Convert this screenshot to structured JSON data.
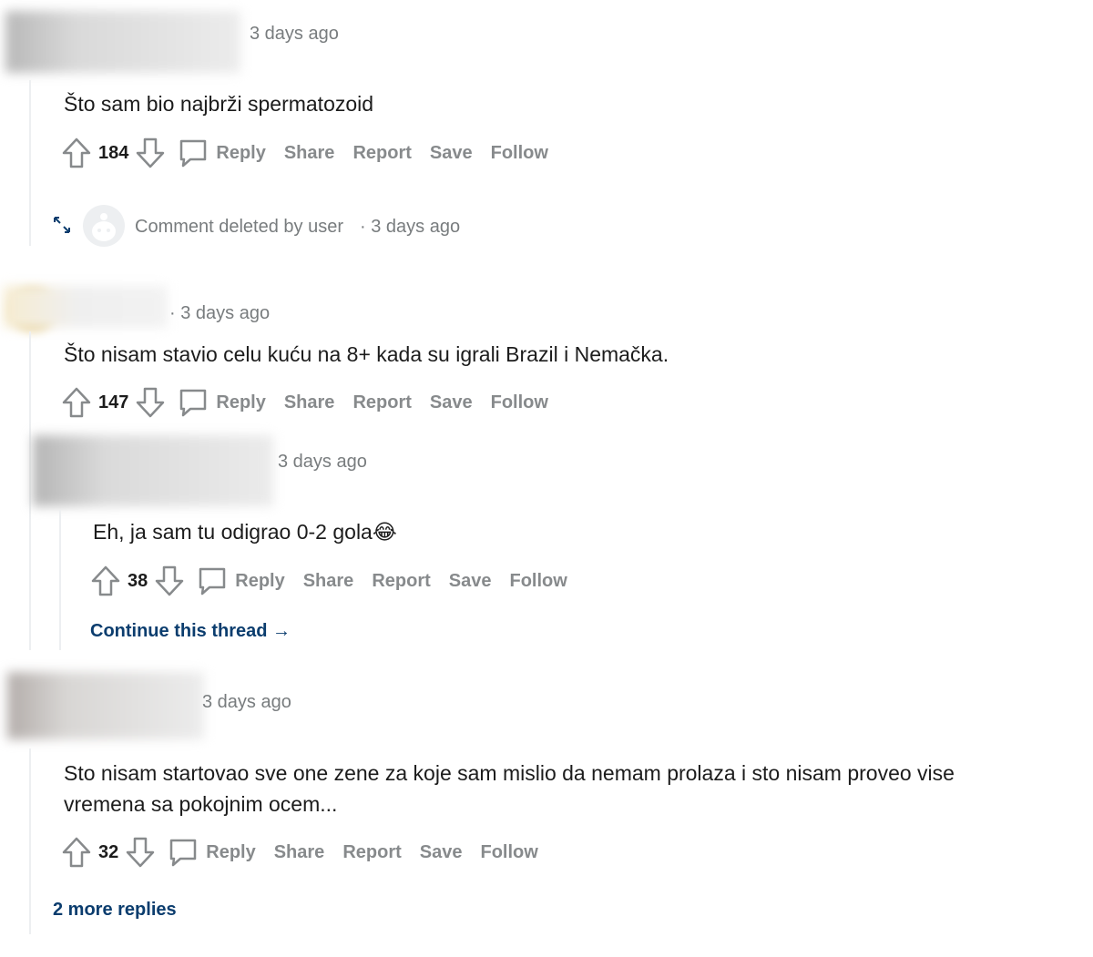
{
  "comments": [
    {
      "time": "3 days ago",
      "body": "Što sam bio najbrži spermatozoid",
      "votes": "184",
      "actions": [
        "Reply",
        "Share",
        "Report",
        "Save",
        "Follow"
      ],
      "deleted_reply": {
        "text": "Comment deleted by user",
        "time": "· 3 days ago"
      }
    },
    {
      "time": "· 3 days ago",
      "body": "Što nisam stavio celu kuću na 8+ kada su igrali Brazil i Nemačka.",
      "votes": "147",
      "actions": [
        "Reply",
        "Share",
        "Report",
        "Save",
        "Follow"
      ],
      "reply": {
        "time": "3 days ago",
        "body": "Eh, ja sam tu odigrao 0-2 gola😂",
        "votes": "38",
        "actions": [
          "Reply",
          "Share",
          "Report",
          "Save",
          "Follow"
        ],
        "continue_link": "Continue this thread →"
      }
    },
    {
      "time": "3 days ago",
      "body": "Sto nisam startovao sve one zene za koje sam mislio da nemam prolaza i sto nisam proveo vise vremena sa pokojnim ocem...",
      "votes": "32",
      "actions": [
        "Reply",
        "Share",
        "Report",
        "Save",
        "Follow"
      ],
      "more_replies": "2 more replies"
    }
  ],
  "icons": {
    "upvote": "upvote-arrow-icon",
    "downvote": "downvote-arrow-icon",
    "reply": "speech-bubble-icon",
    "expand": "expand-arrows-icon",
    "avatar": "default-snoo-avatar-icon"
  },
  "colors": {
    "link": "#0b3d6e",
    "muted": "#878a8c",
    "thread_line": "#edeff1"
  }
}
